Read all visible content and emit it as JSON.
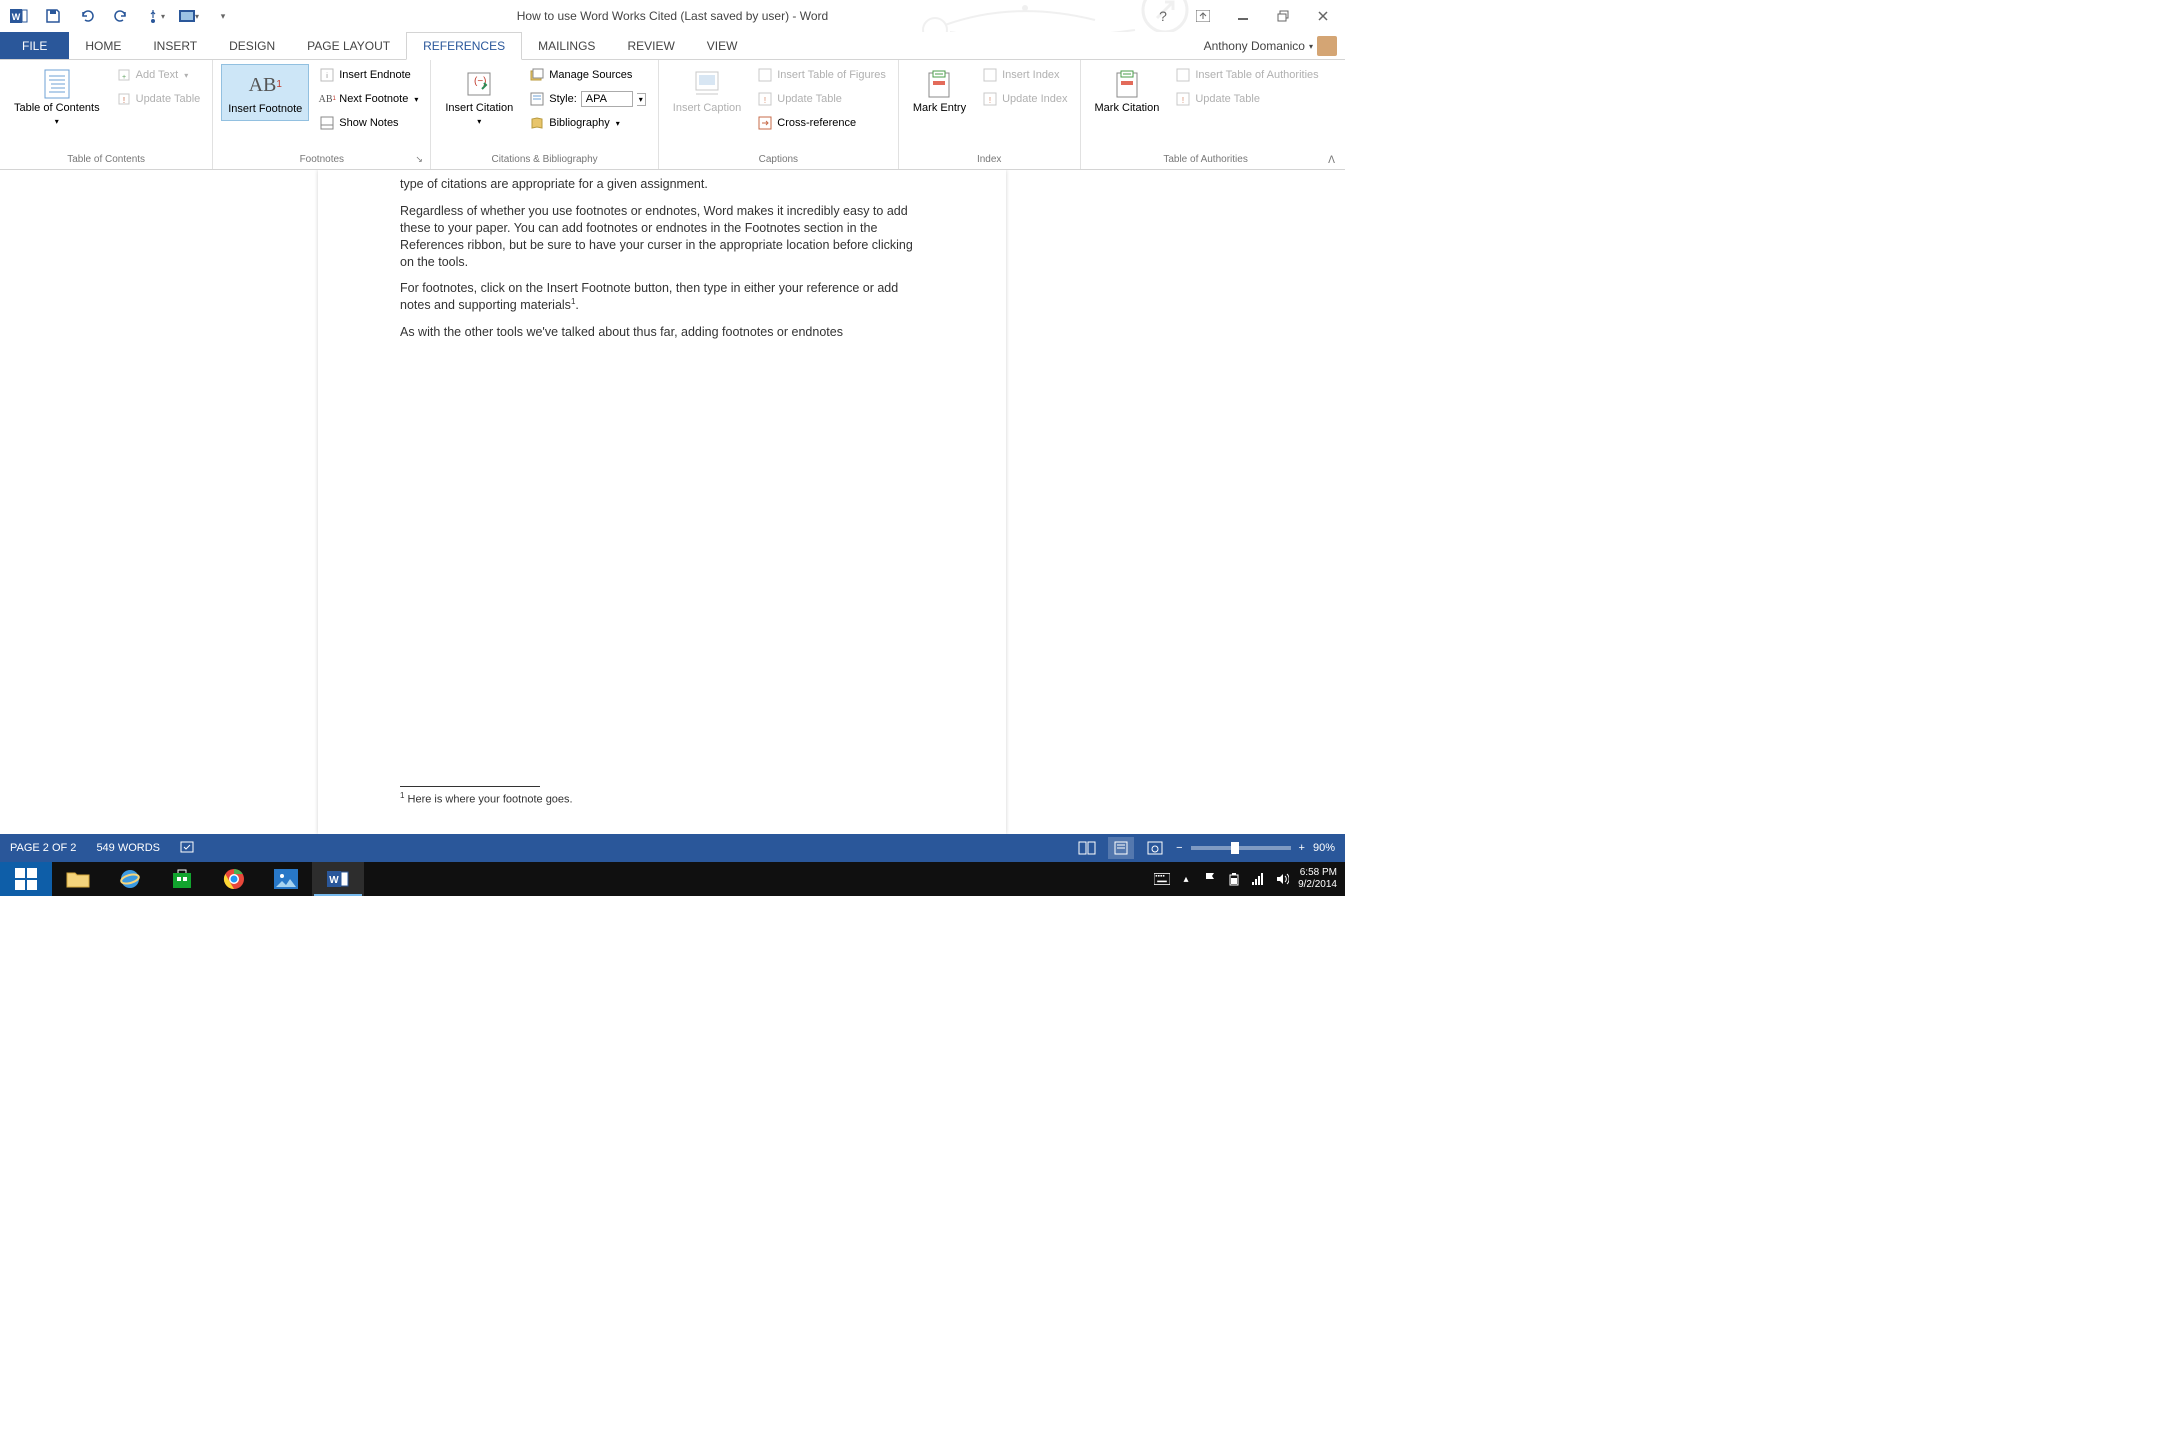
{
  "window": {
    "title": "How to use Word Works Cited (Last saved by user) - Word",
    "user_name": "Anthony Domanico"
  },
  "tabs": {
    "file": "FILE",
    "home": "HOME",
    "insert": "INSERT",
    "design": "DESIGN",
    "page_layout": "PAGE LAYOUT",
    "references": "REFERENCES",
    "mailings": "MAILINGS",
    "review": "REVIEW",
    "view": "VIEW"
  },
  "ribbon": {
    "toc": {
      "label": "Table of Contents",
      "toc_btn": "Table of Contents",
      "add_text": "Add Text",
      "update_table": "Update Table"
    },
    "footnotes": {
      "label": "Footnotes",
      "insert_footnote": "Insert Footnote",
      "insert_endnote": "Insert Endnote",
      "next_footnote": "Next Footnote",
      "show_notes": "Show Notes"
    },
    "citations": {
      "label": "Citations & Bibliography",
      "insert_citation": "Insert Citation",
      "manage_sources": "Manage Sources",
      "style_label": "Style:",
      "style_value": "APA",
      "bibliography": "Bibliography"
    },
    "captions": {
      "label": "Captions",
      "insert_caption": "Insert Caption",
      "insert_tof": "Insert Table of Figures",
      "update_table": "Update Table",
      "cross_ref": "Cross-reference"
    },
    "index": {
      "label": "Index",
      "mark_entry": "Mark Entry",
      "insert_index": "Insert Index",
      "update_index": "Update Index"
    },
    "toa": {
      "label": "Table of Authorities",
      "mark_citation": "Mark Citation",
      "insert_toa": "Insert Table of Authorities",
      "update_table": "Update Table"
    }
  },
  "document": {
    "para1": "type of citations are appropriate for a given assignment.",
    "para2": "Regardless of whether you use footnotes or endnotes, Word makes it incredibly easy to add these to your paper. You can add footnotes or endnotes in the Footnotes section in the References ribbon, but be sure to have your curser in the appropriate location before clicking on the tools.",
    "para3a": "For footnotes, click on the Insert Footnote button, then type in either your reference or add notes and supporting materials",
    "para3b": ".",
    "para4": "As with the other tools we've talked about thus far, adding footnotes or endnotes",
    "footnote_1": " Here is where your footnote goes."
  },
  "status": {
    "page": "PAGE 2 OF 2",
    "words": "549 WORDS",
    "zoom": "90%"
  },
  "system": {
    "time": "6:58 PM",
    "date": "9/2/2014"
  }
}
